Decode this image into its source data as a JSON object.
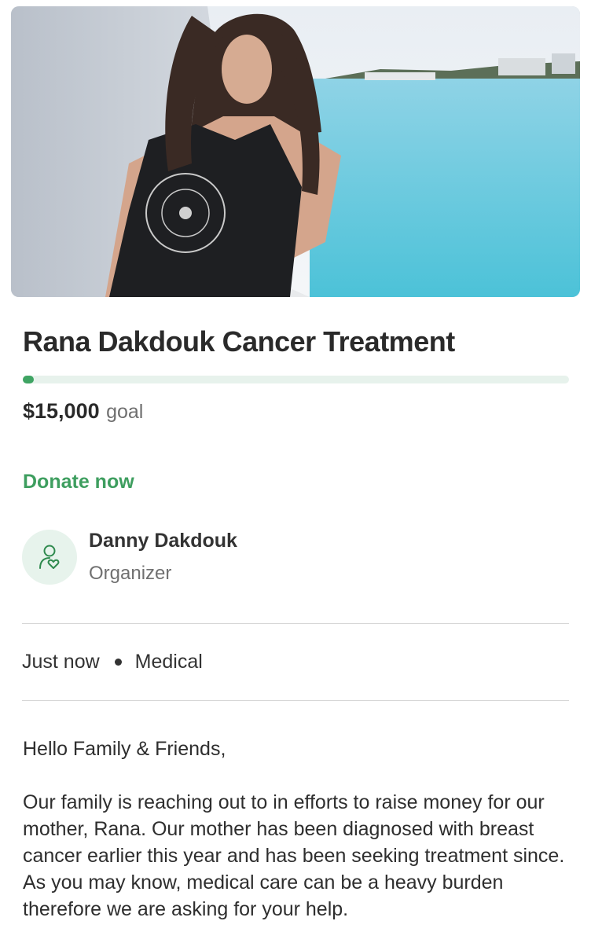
{
  "hero": {
    "image": "fundraiser-cover-photo"
  },
  "campaign": {
    "title": "Rana Dakdouk Cancer Treatment",
    "progress_fraction": 0.02,
    "goal_amount": "$15,000",
    "goal_label": "goal",
    "donate_label": "Donate now"
  },
  "organizer": {
    "icon": "person-heart-icon",
    "name": "Danny Dakdouk",
    "role": "Organizer"
  },
  "meta": {
    "posted": "Just now",
    "category": "Medical"
  },
  "story": {
    "greeting": "Hello Family & Friends,",
    "paragraph": "Our family is reaching out to in efforts to raise money for our mother, Rana. Our mother has been diagnosed with breast cancer earlier this year and has been seeking treatment since. As you may know, medical care can be a heavy burden therefore we are asking for your help."
  },
  "colors": {
    "accent": "#3e9e5f",
    "progress_track": "#e7f2ec",
    "avatar_bg": "#e7f3ec"
  }
}
